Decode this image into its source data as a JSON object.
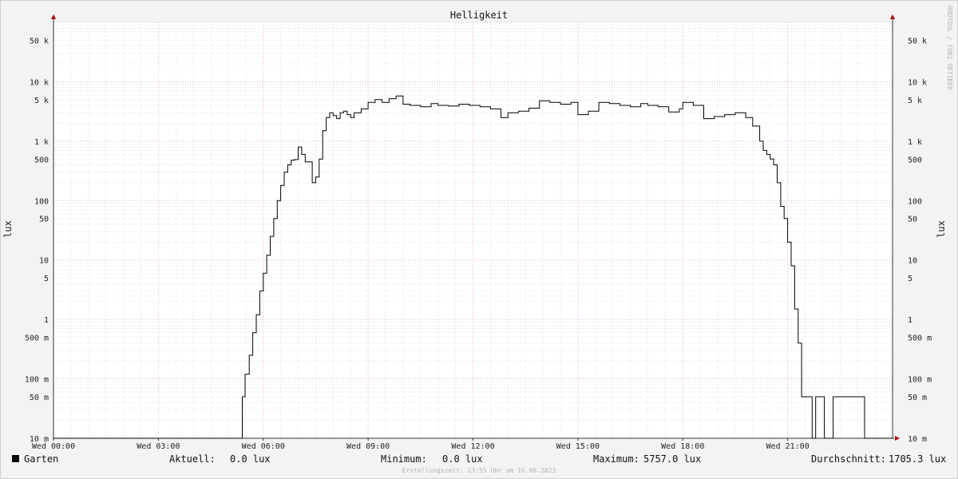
{
  "chart_data": {
    "type": "line",
    "title": "Helligkeit",
    "ylabel": "lux",
    "y_scale": "log",
    "ylim": [
      0.01,
      100000
    ],
    "xlim_hours": [
      0,
      24
    ],
    "credit": "RRDTOOL / TOBI OETIKER",
    "x_ticks": [
      {
        "label": "Wed 00:00",
        "hour": 0
      },
      {
        "label": "Wed 03:00",
        "hour": 3
      },
      {
        "label": "Wed 06:00",
        "hour": 6
      },
      {
        "label": "Wed 09:00",
        "hour": 9
      },
      {
        "label": "Wed 12:00",
        "hour": 12
      },
      {
        "label": "Wed 15:00",
        "hour": 15
      },
      {
        "label": "Wed 18:00",
        "hour": 18
      },
      {
        "label": "Wed 21:00",
        "hour": 21
      }
    ],
    "y_ticks": [
      {
        "label": "10 m",
        "value": 0.01
      },
      {
        "label": "50 m",
        "value": 0.05
      },
      {
        "label": "100 m",
        "value": 0.1
      },
      {
        "label": "500 m",
        "value": 0.5
      },
      {
        "label": "1",
        "value": 1
      },
      {
        "label": "5",
        "value": 5
      },
      {
        "label": "10",
        "value": 10
      },
      {
        "label": "50",
        "value": 50
      },
      {
        "label": "100",
        "value": 100
      },
      {
        "label": "500",
        "value": 500
      },
      {
        "label": "1 k",
        "value": 1000
      },
      {
        "label": "5 k",
        "value": 5000
      },
      {
        "label": "10 k",
        "value": 10000
      },
      {
        "label": "50 k",
        "value": 50000
      }
    ],
    "series": [
      {
        "name": "Garten",
        "color": "#000000",
        "hours": [
          0,
          5.4,
          5.48,
          5.6,
          5.7,
          5.8,
          5.9,
          6.0,
          6.1,
          6.2,
          6.3,
          6.4,
          6.5,
          6.6,
          6.7,
          6.8,
          6.9,
          7.0,
          7.1,
          7.2,
          7.4,
          7.5,
          7.6,
          7.7,
          7.8,
          7.9,
          8.0,
          8.1,
          8.2,
          8.3,
          8.4,
          8.5,
          8.6,
          8.8,
          9.0,
          9.2,
          9.4,
          9.6,
          9.8,
          10.0,
          10.2,
          10.5,
          10.8,
          11.0,
          11.3,
          11.6,
          11.9,
          12.2,
          12.5,
          12.8,
          13.0,
          13.3,
          13.6,
          13.9,
          14.2,
          14.5,
          14.8,
          15.0,
          15.3,
          15.6,
          15.9,
          16.2,
          16.5,
          16.8,
          17.0,
          17.3,
          17.6,
          17.9,
          18.0,
          18.3,
          18.6,
          18.9,
          19.2,
          19.5,
          19.8,
          20.0,
          20.2,
          20.3,
          20.4,
          20.5,
          20.6,
          20.7,
          20.8,
          20.9,
          21.0,
          21.1,
          21.2,
          21.3,
          21.4,
          21.5,
          21.6,
          21.7,
          21.8,
          21.9,
          22.05,
          22.15,
          22.3,
          22.5,
          22.8,
          23.2,
          23.5,
          23.8
        ],
        "values": [
          0.01,
          0.05,
          0.12,
          0.25,
          0.6,
          1.2,
          3,
          6,
          12,
          25,
          50,
          100,
          180,
          300,
          400,
          480,
          490,
          800,
          600,
          450,
          200,
          250,
          500,
          1500,
          2500,
          3000,
          2700,
          2400,
          3000,
          3200,
          2800,
          2500,
          3000,
          3500,
          4500,
          5000,
          4500,
          5200,
          5757,
          4200,
          4000,
          3800,
          4300,
          4000,
          3900,
          4200,
          4000,
          3800,
          3500,
          2500,
          3000,
          3200,
          3600,
          4800,
          4500,
          4200,
          4500,
          2800,
          3200,
          4500,
          4300,
          4000,
          3800,
          4300,
          4000,
          3800,
          3100,
          3500,
          4500,
          4000,
          2400,
          2600,
          2800,
          3000,
          2500,
          1800,
          1000,
          700,
          600,
          500,
          400,
          200,
          80,
          50,
          20,
          8,
          1.5,
          0.4,
          0.05,
          0.05,
          0.05,
          0.01,
          0.05,
          0.05,
          0.01,
          0.01,
          0.05,
          0.05,
          0.05,
          0.01,
          0.01,
          0.01
        ]
      }
    ]
  },
  "legend": {
    "series_label": "Garten",
    "current_label": "Aktuell:",
    "current_value": "0.0 lux",
    "min_label": "Minimum:",
    "min_value": "0.0 lux",
    "max_label": "Maximum:",
    "max_value": "5757.0 lux",
    "avg_label": "Durchschnitt:",
    "avg_value": "1705.3 lux"
  },
  "footer": "Erstellungszeit: 23:55 Uhr am 16.08.2023"
}
